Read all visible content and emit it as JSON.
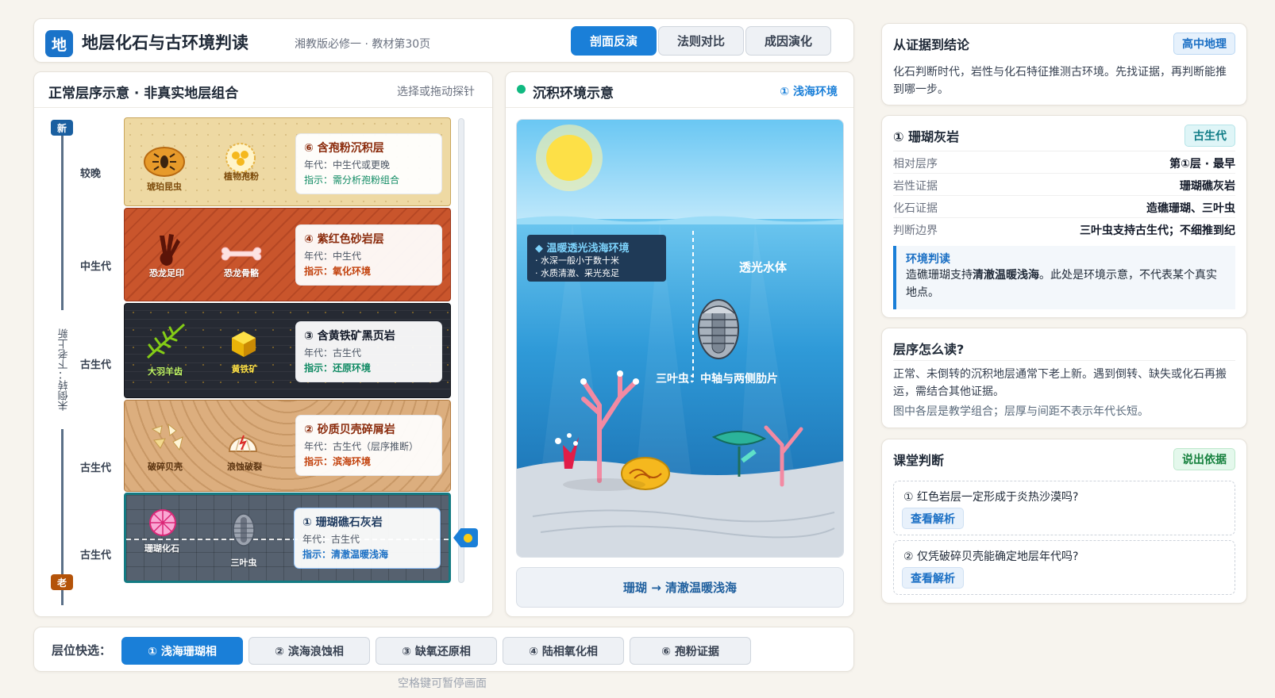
{
  "header": {
    "logo": "地",
    "title": "地层化石与古环境判读",
    "subtitle": "湘教版必修一 · 教材第30页",
    "tabs": [
      {
        "label": "剖面反演",
        "active": true
      },
      {
        "label": "法则对比",
        "active": false
      },
      {
        "label": "成因演化",
        "active": false
      }
    ]
  },
  "strata": {
    "title": "正常层序示意 · 非真实地层组合",
    "hint": "选择或拖动探针",
    "axis_new": "新",
    "axis_old": "老",
    "axis_label": "未倒转：下老上新",
    "era_labels": [
      "较晚",
      "中生代",
      "古生代",
      "古生代",
      "古生代"
    ],
    "layers": [
      {
        "name": "⑥ 含孢粉沉积层",
        "age": "年代：中生代或更晚",
        "indicator_label": "指示：",
        "indicator": "需分析孢粉组合",
        "fossil1": "琥珀昆虫",
        "fossil2": "植物孢粉",
        "color": "#eed9a3",
        "name_color": "#8a2a0b",
        "ind_color": "#0f8a63"
      },
      {
        "name": "④ 紫红色砂岩层",
        "age": "年代：中生代",
        "indicator_label": "指示：",
        "indicator": "氧化环境",
        "fossil1": "恐龙足印",
        "fossil2": "恐龙骨骼",
        "color": "#c9552c",
        "name_color": "#8a2a0b",
        "ind_color": "#c2410c"
      },
      {
        "name": "③ 含黄铁矿黑页岩",
        "age": "年代：古生代",
        "indicator_label": "指示：",
        "indicator": "还原环境",
        "fossil1": "大羽羊齿",
        "fossil2": "黄铁矿",
        "color": "#262a33",
        "name_color": "#111827",
        "ind_color": "#0f8a63"
      },
      {
        "name": "② 砂质贝壳碎屑岩",
        "age": "年代：古生代（层序推断）",
        "indicator_label": "指示：",
        "indicator": "滨海环境",
        "fossil1": "破碎贝壳",
        "fossil2": "浪蚀破裂",
        "color": "#dcae7e",
        "name_color": "#8a2a0b",
        "ind_color": "#c2410c"
      },
      {
        "name": "① 珊瑚礁石灰岩",
        "age": "年代：古生代",
        "indicator_label": "指示：",
        "indicator": "清澈温暖浅海",
        "fossil1": "珊瑚化石",
        "fossil2": "三叶虫",
        "color": "#56616f",
        "name_color": "#1e3a5f",
        "ind_color": "#1a6fc4"
      }
    ]
  },
  "environment": {
    "title": "沉积环境示意",
    "tag": "① 浅海环境",
    "info_title": "◆ 温暖透光浅海环境",
    "info_lines": [
      "· 水深一般小于数十米",
      "· 水质清澈、采光充足"
    ],
    "water_label": "透光水体",
    "trilobite_label": "三叶虫：中轴与两侧肋片",
    "banner": "珊瑚 → 清澈温暖浅海"
  },
  "quick": {
    "label": "层位快选：",
    "buttons": [
      {
        "label": "① 浅海珊瑚相",
        "active": true
      },
      {
        "label": "② 滨海浪蚀相",
        "active": false
      },
      {
        "label": "③ 缺氧还原相",
        "active": false
      },
      {
        "label": "④ 陆相氧化相",
        "active": false
      },
      {
        "label": "⑥ 孢粉证据",
        "active": false
      }
    ],
    "pause_hint": "空格键可暂停画面"
  },
  "sidebar": {
    "evidence": {
      "title": "从证据到结论",
      "badge": "高中地理",
      "text": "化石判断时代，岩性与化石特征推测古环境。先找证据，再判断能推到哪一步。"
    },
    "detail": {
      "title": "① 珊瑚灰岩",
      "badge": "古生代",
      "rows": [
        {
          "key": "相对层序",
          "value": "第①层 · 最早"
        },
        {
          "key": "岩性证据",
          "value": "珊瑚礁灰岩"
        },
        {
          "key": "化石证据",
          "value": "造礁珊瑚、三叶虫"
        },
        {
          "key": "判断边界",
          "value": "三叶虫支持古生代；不细推到纪"
        }
      ],
      "judge_title": "环境判读",
      "judge_pre": "造礁珊瑚支持",
      "judge_bold": "清澈温暖浅海",
      "judge_post": "。此处是环境示意，不代表某个真实地点。"
    },
    "howto": {
      "title": "层序怎么读?",
      "text": "正常、未倒转的沉积地层通常下老上新。遇到倒转、缺失或化石再搬运，需结合其他证据。",
      "note": "图中各层是教学组合；层厚与间距不表示年代长短。"
    },
    "quiz": {
      "title": "课堂判断",
      "badge": "说出依据",
      "items": [
        {
          "question": "① 红色岩层一定形成于炎热沙漠吗?",
          "button": "查看解析"
        },
        {
          "question": "② 仅凭破碎贝壳能确定地层年代吗?",
          "button": "查看解析"
        }
      ]
    }
  },
  "colors": {
    "accent": "#1a7fd8",
    "green": "#10b981"
  }
}
